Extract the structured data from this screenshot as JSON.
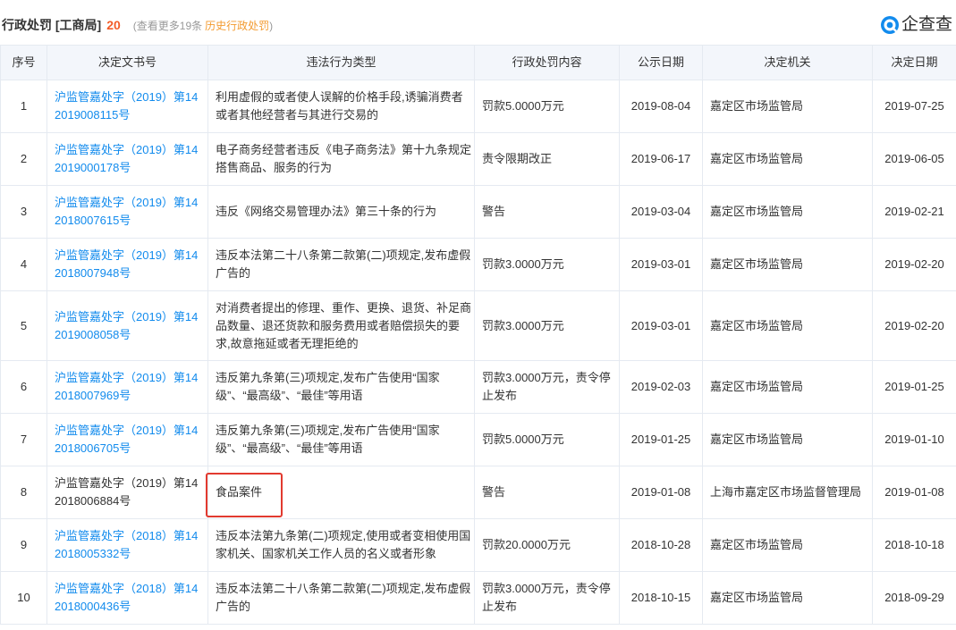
{
  "section": {
    "title": "行政处罚 [工商局]",
    "count": "20",
    "more_open": "(查看更多19条",
    "more_link": "历史行政处罚",
    "more_close": ")"
  },
  "logo": {
    "icon": "qichacha-logo-icon",
    "text": "企查查"
  },
  "colors": {
    "link": "#128bed",
    "count": "#f35b27",
    "history_link": "#f39b30",
    "text": "#333333",
    "muted": "#999999",
    "header_bg": "#f3f6fb",
    "border": "#e5eaf1",
    "highlight_box": "#e23a2f",
    "logo_blue": "#128bed"
  },
  "table": {
    "columns": [
      "序号",
      "决定文书号",
      "违法行为类型",
      "行政处罚内容",
      "公示日期",
      "决定机关",
      "决定日期"
    ],
    "rows": [
      {
        "index": "1",
        "doc_no": "沪监管嘉处字（2019）第142019008115号",
        "violation": "利用虚假的或者使人误解的价格手段,诱骗消费者或者其他经营者与其进行交易的",
        "penalty": "罚款5.0000万元",
        "publish_date": "2019-08-04",
        "authority": "嘉定区市场监管局",
        "decision_date": "2019-07-25"
      },
      {
        "index": "2",
        "doc_no": "沪监管嘉处字（2019）第142019000178号",
        "violation": "电子商务经营者违反《电子商务法》第十九条规定搭售商品、服务的行为",
        "penalty": "责令限期改正",
        "publish_date": "2019-06-17",
        "authority": "嘉定区市场监管局",
        "decision_date": "2019-06-05"
      },
      {
        "index": "3",
        "doc_no": "沪监管嘉处字（2019）第142018007615号",
        "violation": "违反《网络交易管理办法》第三十条的行为",
        "penalty": "警告",
        "publish_date": "2019-03-04",
        "authority": "嘉定区市场监管局",
        "decision_date": "2019-02-21"
      },
      {
        "index": "4",
        "doc_no": "沪监管嘉处字（2019）第142018007948号",
        "violation": "违反本法第二十八条第二款第(二)项规定,发布虚假广告的",
        "penalty": "罚款3.0000万元",
        "publish_date": "2019-03-01",
        "authority": "嘉定区市场监管局",
        "decision_date": "2019-02-20"
      },
      {
        "index": "5",
        "doc_no": "沪监管嘉处字（2019）第142019008058号",
        "violation": "对消费者提出的修理、重作、更换、退货、补足商品数量、退还货款和服务费用或者赔偿损失的要求,故意拖延或者无理拒绝的",
        "penalty": "罚款3.0000万元",
        "publish_date": "2019-03-01",
        "authority": "嘉定区市场监管局",
        "decision_date": "2019-02-20"
      },
      {
        "index": "6",
        "doc_no": "沪监管嘉处字（2019）第142018007969号",
        "violation": "违反第九条第(三)项规定,发布广告使用“国家级”、“最高级”、“最佳”等用语",
        "penalty": "罚款3.0000万元，责令停止发布",
        "publish_date": "2019-02-03",
        "authority": "嘉定区市场监管局",
        "decision_date": "2019-01-25"
      },
      {
        "index": "7",
        "doc_no": "沪监管嘉处字（2019）第142018006705号",
        "violation": "违反第九条第(三)项规定,发布广告使用“国家级”、“最高级”、“最佳”等用语",
        "penalty": "罚款5.0000万元",
        "publish_date": "2019-01-25",
        "authority": "嘉定区市场监管局",
        "decision_date": "2019-01-10"
      },
      {
        "index": "8",
        "doc_no": "沪监管嘉处字（2019）第142018006884号",
        "violation": "食品案件",
        "penalty": "警告",
        "publish_date": "2019-01-08",
        "authority": "上海市嘉定区市场监督管理局",
        "decision_date": "2019-01-08"
      },
      {
        "index": "9",
        "doc_no": "沪监管嘉处字（2018）第142018005332号",
        "violation": "违反本法第九条第(二)项规定,使用或者变相使用国家机关、国家机关工作人员的名义或者形象",
        "penalty": "罚款20.0000万元",
        "publish_date": "2018-10-28",
        "authority": "嘉定区市场监管局",
        "decision_date": "2018-10-18"
      },
      {
        "index": "10",
        "doc_no": "沪监管嘉处字（2018）第142018000436号",
        "violation": "违反本法第二十八条第二款第(二)项规定,发布虚假广告的",
        "penalty": "罚款3.0000万元，责令停止发布",
        "publish_date": "2018-10-15",
        "authority": "嘉定区市场监管局",
        "decision_date": "2018-09-29"
      }
    ]
  }
}
